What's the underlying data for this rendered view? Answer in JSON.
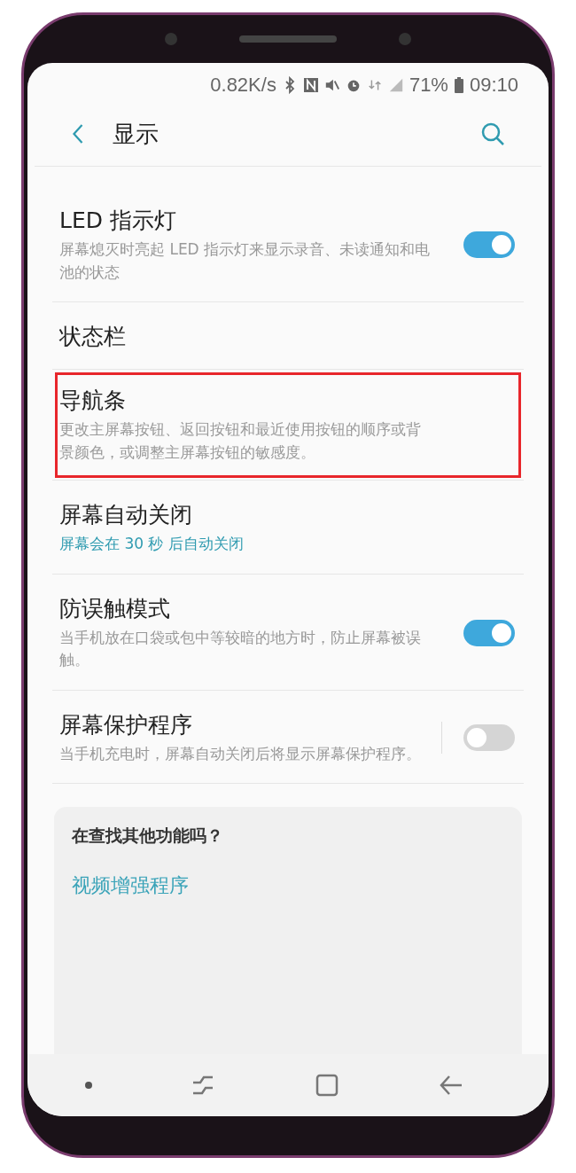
{
  "status_bar": {
    "speed": "0.82K/s",
    "battery": "71%",
    "time": "09:10"
  },
  "header": {
    "title": "显示"
  },
  "items": [
    {
      "kind": "toggle",
      "title": "LED 指示灯",
      "subtitle": "屏幕熄灭时亮起 LED 指示灯来显示录音、未读通知和电池的状态",
      "on": true,
      "highlighted": false
    },
    {
      "kind": "plain",
      "title": "状态栏",
      "highlighted": false
    },
    {
      "kind": "plain",
      "title": "导航条",
      "subtitle": "更改主屏幕按钮、返回按钮和最近使用按钮的顺序或背景颜色，或调整主屏幕按钮的敏感度。",
      "highlighted": true
    },
    {
      "kind": "value",
      "title": "屏幕自动关闭",
      "subtitle": "屏幕会在 30 秒 后自动关闭",
      "highlighted": false
    },
    {
      "kind": "toggle",
      "title": "防误触模式",
      "subtitle": "当手机放在口袋或包中等较暗的地方时，防止屏幕被误触。",
      "on": true,
      "highlighted": false
    },
    {
      "kind": "toggle",
      "title": "屏幕保护程序",
      "subtitle": "当手机充电时，屏幕自动关闭后将显示屏幕保护程序。",
      "on": false,
      "divider": true,
      "highlighted": false
    }
  ],
  "suggestions": {
    "title": "在查找其他功能吗？",
    "links": [
      "视频增强程序"
    ]
  }
}
